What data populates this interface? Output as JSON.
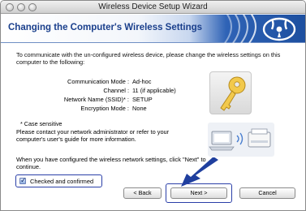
{
  "window": {
    "title": "Wireless Device Setup Wizard"
  },
  "banner": {
    "title": "Changing the Computer's Wireless Settings"
  },
  "intro": "To communicate with the un-configured wireless device, please change the wireless settings on this computer to the following:",
  "settings": [
    {
      "label": "Communication Mode :",
      "value": "Ad-hoc"
    },
    {
      "label": "Channel :",
      "value": "11  (if applicable)"
    },
    {
      "label": "Network Name (SSID)* :",
      "value": "SETUP"
    },
    {
      "label": "Encryption Mode :",
      "value": "None"
    }
  ],
  "case_note": "* Case sensitive",
  "contact_text": "Please contact your network administrator or refer to your computer's user's guide for more information.",
  "configured_text": "When you have configured the wireless network settings, click \"Next\" to continue.",
  "checkbox": {
    "label": "Checked and confirmed",
    "checked": true
  },
  "buttons": {
    "back": "< Back",
    "next": "Next >",
    "cancel": "Cancel"
  },
  "colors": {
    "accent": "#2a3fa8",
    "banner_blue": "#1d4f9f",
    "title_blue": "#1a3f8c"
  },
  "icons": [
    "key-icon",
    "wireless-icon",
    "arrow-icon",
    "laptop-icon",
    "printer-icon"
  ]
}
